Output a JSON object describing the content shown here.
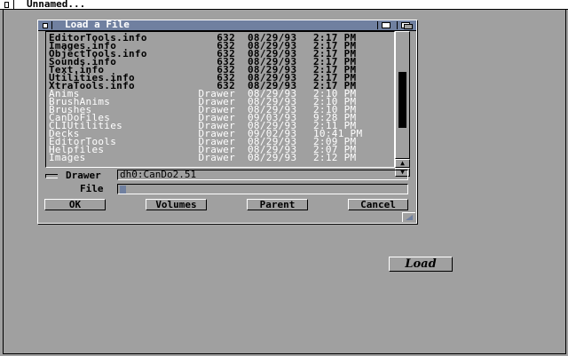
{
  "screen": {
    "title": "Unnamed..."
  },
  "requester": {
    "title": "Load a File",
    "files": [
      {
        "name": "EditorTools.info",
        "size": "632",
        "date": "08/29/93",
        "time": "2:17 PM",
        "kind": "file"
      },
      {
        "name": "Images.info",
        "size": "632",
        "date": "08/29/93",
        "time": "2:17 PM",
        "kind": "file"
      },
      {
        "name": "ObjectTools.info",
        "size": "632",
        "date": "08/29/93",
        "time": "2:17 PM",
        "kind": "file"
      },
      {
        "name": "Sounds.info",
        "size": "632",
        "date": "08/29/93",
        "time": "2:17 PM",
        "kind": "file"
      },
      {
        "name": "Text.info",
        "size": "632",
        "date": "08/29/93",
        "time": "2:17 PM",
        "kind": "file"
      },
      {
        "name": "Utilities.info",
        "size": "632",
        "date": "08/29/93",
        "time": "2:17 PM",
        "kind": "file"
      },
      {
        "name": "XtraTools.info",
        "size": "632",
        "date": "08/29/93",
        "time": "2:17 PM",
        "kind": "file"
      },
      {
        "name": "Anims",
        "size": "Drawer",
        "date": "08/29/93",
        "time": "2:10 PM",
        "kind": "drawer"
      },
      {
        "name": "BrushAnims",
        "size": "Drawer",
        "date": "08/29/93",
        "time": "2:10 PM",
        "kind": "drawer"
      },
      {
        "name": "Brushes",
        "size": "Drawer",
        "date": "08/29/93",
        "time": "2:10 PM",
        "kind": "drawer"
      },
      {
        "name": "CanDoFiles",
        "size": "Drawer",
        "date": "09/03/93",
        "time": "9:28 PM",
        "kind": "drawer"
      },
      {
        "name": "CLIUtilities",
        "size": "Drawer",
        "date": "08/29/93",
        "time": "2:11 PM",
        "kind": "drawer"
      },
      {
        "name": "Decks",
        "size": "Drawer",
        "date": "09/02/93",
        "time": "10:41 PM",
        "kind": "drawer"
      },
      {
        "name": "EditorTools",
        "size": "Drawer",
        "date": "08/29/93",
        "time": "2:09 PM",
        "kind": "drawer"
      },
      {
        "name": "Helpfiles",
        "size": "Drawer",
        "date": "08/29/93",
        "time": "2:07 PM",
        "kind": "drawer"
      },
      {
        "name": "Images",
        "size": "Drawer",
        "date": "08/29/93",
        "time": "2:12 PM",
        "kind": "drawer"
      }
    ],
    "scroll_up": "▲",
    "scroll_down": "▼",
    "drawer_label": "Drawer",
    "drawer_value": "dh0:CanDo2.51",
    "file_label": "File",
    "file_value": "",
    "buttons": {
      "ok": "OK",
      "volumes": "Volumes",
      "parent": "Parent",
      "cancel": "Cancel"
    }
  },
  "load_button": "Load"
}
